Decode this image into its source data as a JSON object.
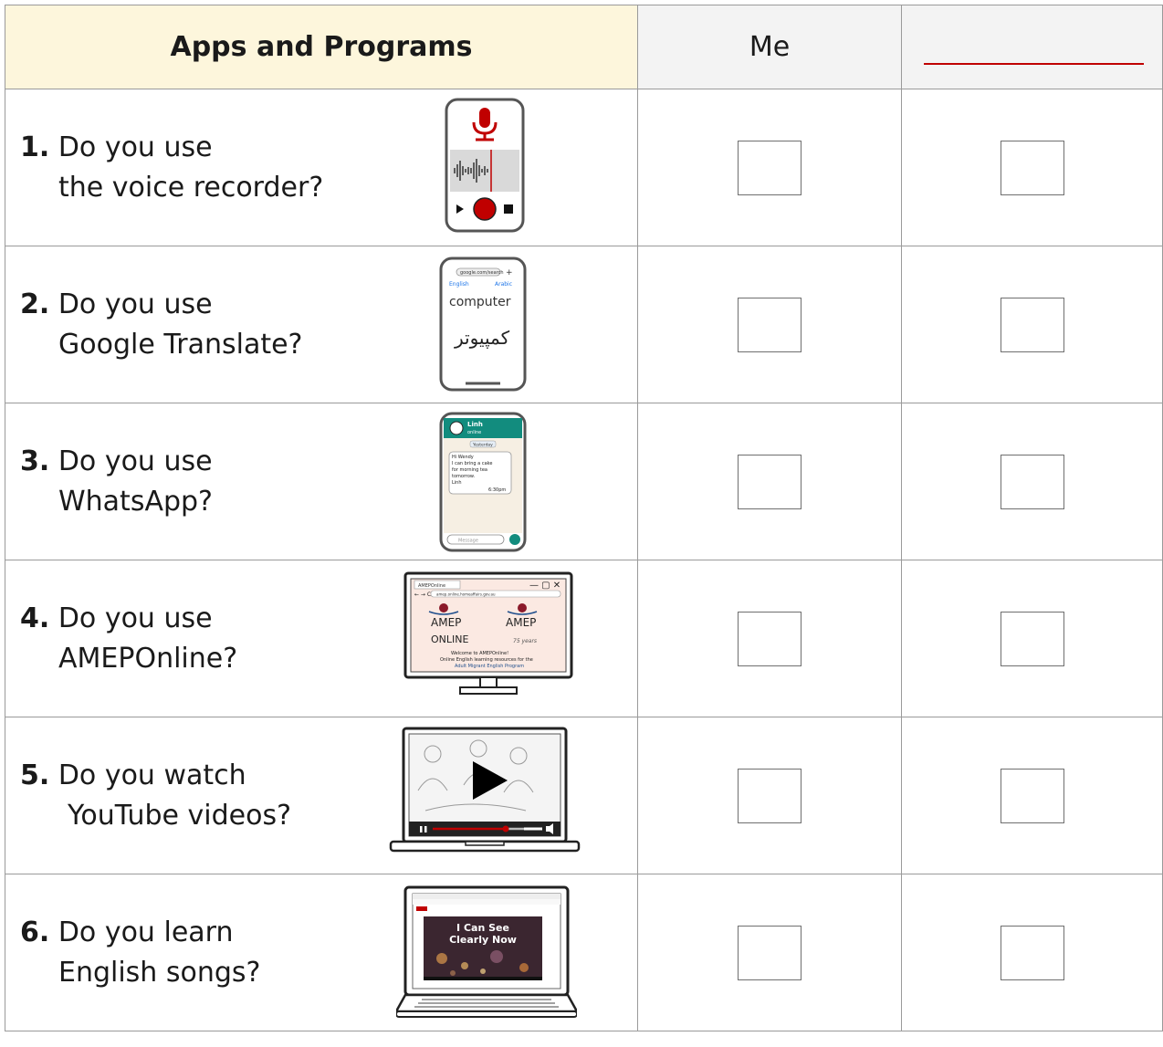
{
  "header": {
    "title": "Apps and Programs",
    "me": "Me"
  },
  "questions": [
    {
      "number": "1.",
      "line1": "Do you use",
      "line2": "the voice recorder?",
      "icon": "voice-recorder-phone-icon"
    },
    {
      "number": "2.",
      "line1": "Do you use",
      "line2": "Google Translate?",
      "icon": "google-translate-phone-icon"
    },
    {
      "number": "3.",
      "line1": "Do you use",
      "line2": "WhatsApp?",
      "icon": "whatsapp-phone-icon"
    },
    {
      "number": "4.",
      "line1": "Do you use",
      "line2": "AMEPOnline?",
      "icon": "amep-online-monitor-icon"
    },
    {
      "number": "5.",
      "line1": "Do you watch",
      "line2": "YouTube videos?",
      "icon": "youtube-video-laptop-icon"
    },
    {
      "number": "6.",
      "line1": "Do you learn",
      "line2": "English songs?",
      "icon": "english-songs-laptop-icon"
    }
  ],
  "illustrations": {
    "translate": {
      "url": "google.com/search",
      "from": "English",
      "to": "Arabic",
      "word": "computer",
      "translation": "کمپیوتر"
    },
    "whatsapp": {
      "contact": "Linh",
      "status": "online",
      "date": "Yesterday",
      "msg1": "Hi Wendy",
      "msg2": "I can bring a cake",
      "msg3": "for morning tea",
      "msg4": "tomorrow.",
      "msg5": "Linh",
      "time": "6:30pm",
      "placeholder": "Message"
    },
    "amep": {
      "tab": "AMEPOnline",
      "url": "amep.online.homeaffairs.gov.au",
      "logo1": "AMEP",
      "logo1_sub": "ONLINE",
      "logo2": "AMEP",
      "logo2_sub": "75 years",
      "welcome": "Welcome to AMEPOnline!",
      "line2": "Online English learning resources for the",
      "line3": "Adult Migrant English Program"
    },
    "songs": {
      "title1": "I Can See",
      "title2": "Clearly Now"
    }
  },
  "colors": {
    "header_title_bg": "#fdf6dc",
    "header_bg": "#f3f3f3",
    "accent_red": "#c00000",
    "whatsapp_green": "#128c7e"
  }
}
